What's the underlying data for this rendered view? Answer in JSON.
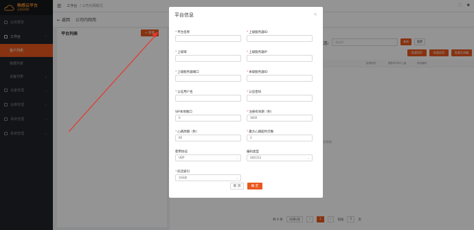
{
  "sidebar": {
    "logo_title": "畅感云平台",
    "logo_sub": "全感知物联",
    "items": [
      {
        "label": "业务概览"
      },
      {
        "label": "工作台"
      },
      {
        "label": "客户列表"
      },
      {
        "label": "数据列表"
      },
      {
        "label": "设备列表"
      },
      {
        "label": "设备管理"
      },
      {
        "label": "运维管理"
      },
      {
        "label": "系统管理"
      },
      {
        "label": "系统管理"
      }
    ]
  },
  "header": {
    "menu_icon": "menu-icon",
    "crumb": "工作台",
    "crumb2": "/ 公司内网概况"
  },
  "page": {
    "back": "← 返回",
    "title": "公司内网用"
  },
  "left_panel": {
    "title": "平台列表",
    "add_button": "+ 新增"
  },
  "right_panel": {
    "filter_label": "在线状态:",
    "filter_placeholder": "请选择",
    "search_button": "查询",
    "reset_button": "重置",
    "action_buttons": [
      "批量同步",
      "批量启用",
      "批量生成编"
    ],
    "columns": [
      "检测状态",
      "国标SIP本口上级",
      "状态编码"
    ],
    "empty_text": "暂无数据",
    "pager": {
      "total": "共 0 条",
      "page_size": "10条/页",
      "current": "1",
      "goto_label": "前往",
      "goto_value": "1",
      "goto_suffix": "页"
    }
  },
  "modal": {
    "title": "平台信息",
    "close": "×",
    "fields": [
      {
        "label": "平台名称",
        "required": true,
        "value": ""
      },
      {
        "label": "上级服务器ID",
        "required": true,
        "value": ""
      },
      {
        "label": "上级域",
        "required": true,
        "value": ""
      },
      {
        "label": "上级服务器IP",
        "required": true,
        "value": ""
      },
      {
        "label": "上级服务器端口",
        "required": true,
        "value": ""
      },
      {
        "label": "本级服务器ID",
        "required": true,
        "value": ""
      },
      {
        "label": "认证用户名",
        "required": true,
        "value": ""
      },
      {
        "label": "认证密码",
        "required": true,
        "value": ""
      },
      {
        "label": "SIP本地端口",
        "required": false,
        "value": "0"
      },
      {
        "label": "注册有效期（秒）",
        "required": true,
        "value": "3600"
      },
      {
        "label": "心跳周期（秒）",
        "required": true,
        "value": "60"
      },
      {
        "label": "最大心跳超时次数",
        "required": true,
        "value": "3"
      },
      {
        "label": "使用协议",
        "required": false,
        "value": "UDP",
        "select": true
      },
      {
        "label": "编码类型",
        "required": false,
        "value": "GB2312",
        "select": true
      },
      {
        "label": "码流索引",
        "required": true,
        "value": "主码流",
        "select": true
      }
    ],
    "cancel": "取 消",
    "ok": "确 定"
  },
  "colors": {
    "accent": "#e9581e",
    "sidebar": "#1f2329"
  }
}
